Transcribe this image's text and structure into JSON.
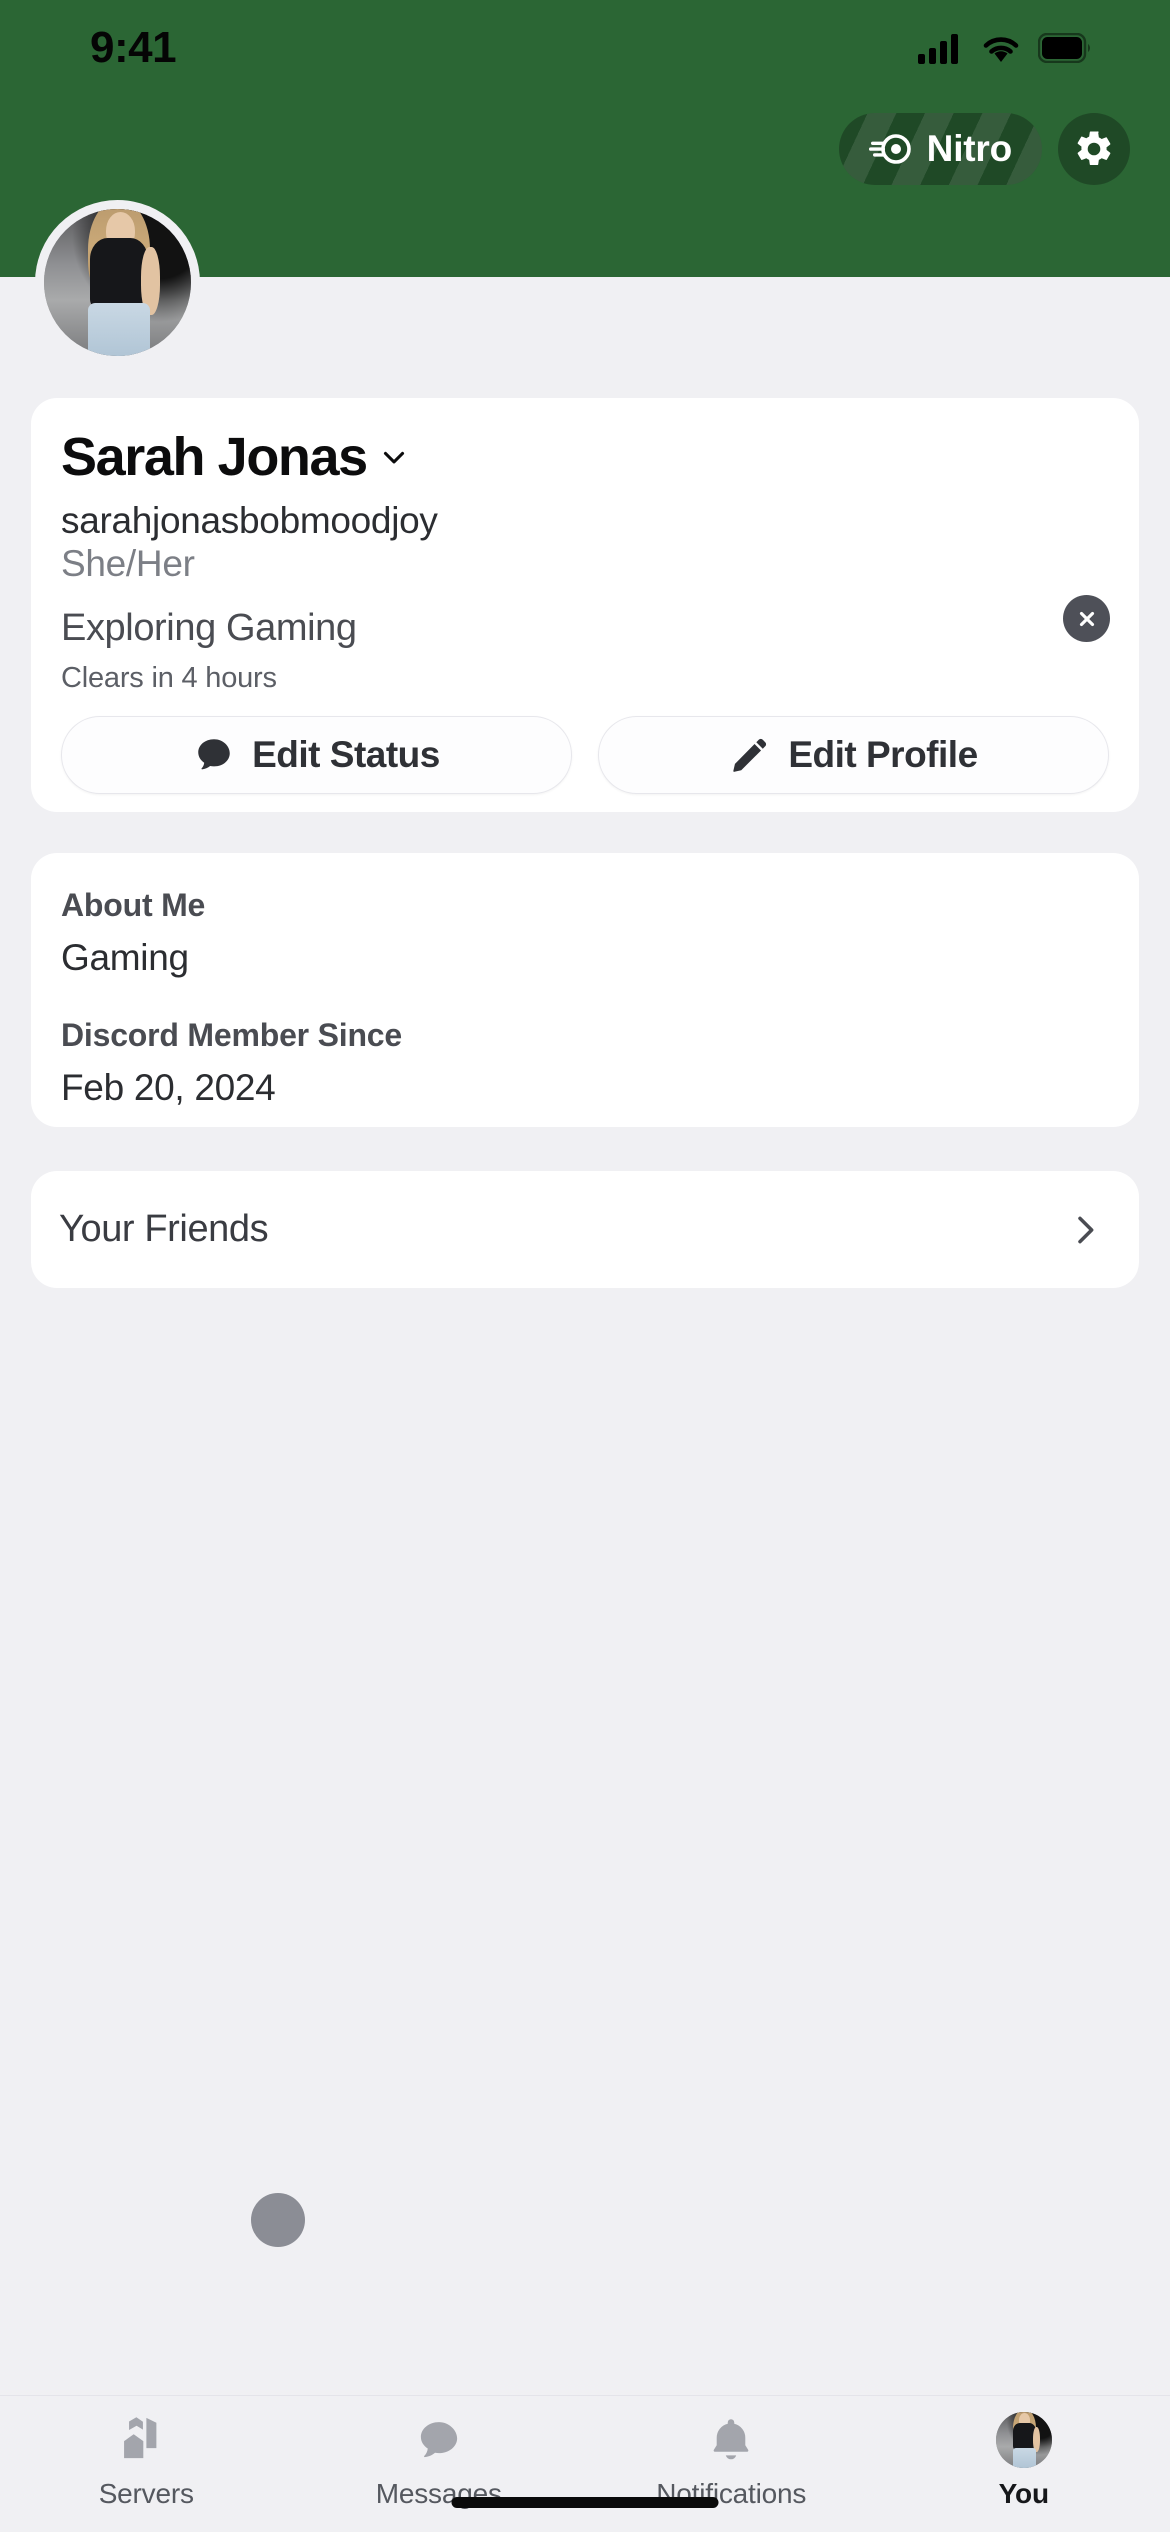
{
  "status_bar": {
    "time": "9:41",
    "icons": [
      "cellular-signal-icon",
      "wifi-icon",
      "battery-icon"
    ]
  },
  "header": {
    "background_color": "#2B6634",
    "nitro_button": {
      "label": "Nitro",
      "icon": "nitro-wheel-icon"
    },
    "settings_button": {
      "icon": "gear-icon"
    }
  },
  "profile": {
    "avatar": "user-avatar",
    "display_name": "Sarah Jonas",
    "name_chevron": "chevron-down-icon",
    "username": "sarahjonasbobmoodjoy",
    "pronouns": "She/Her",
    "custom_status": "Exploring Gaming",
    "status_expiry": "Clears in 4 hours",
    "clear_status_icon": "close-circle-icon",
    "edit_status_button": {
      "label": "Edit Status",
      "icon": "speech-bubble-icon"
    },
    "edit_profile_button": {
      "label": "Edit Profile",
      "icon": "pencil-icon"
    }
  },
  "about": {
    "about_me_title": "About Me",
    "about_me_value": "Gaming",
    "member_since_title": "Discord Member Since",
    "member_since_value": "Feb 20, 2024"
  },
  "friends": {
    "label": "Your Friends",
    "chevron": "chevron-right-icon"
  },
  "tab_bar": {
    "tabs": [
      {
        "label": "Servers",
        "icon": "servers-icon",
        "active": false
      },
      {
        "label": "Messages",
        "icon": "messages-bubble-icon",
        "active": false
      },
      {
        "label": "Notifications",
        "icon": "bell-icon",
        "active": false
      },
      {
        "label": "You",
        "icon": "user-avatar-icon",
        "active": true
      }
    ]
  },
  "colors": {
    "page_background": "#F0F0F3",
    "card_background": "#FFFFFF",
    "banner_green": "#2B6634",
    "nitro_pill": "#1F4926",
    "muted_text": "#7C7F86",
    "icon_gray": "#A3A5AC"
  }
}
